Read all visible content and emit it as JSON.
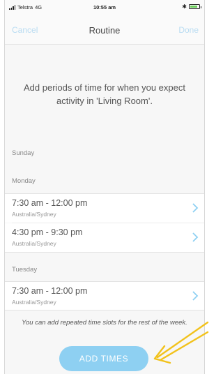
{
  "status_bar": {
    "carrier": "Telstra",
    "network": "4G",
    "time": "10:55 am"
  },
  "nav": {
    "cancel_label": "Cancel",
    "title": "Routine",
    "done_label": "Done"
  },
  "intro_text": "Add periods of time for when you expect activity in 'Living Room'.",
  "days": [
    {
      "label": "Sunday",
      "slots": []
    },
    {
      "label": "Monday",
      "slots": [
        {
          "time": "7:30 am - 12:00 pm",
          "zone": "Australia/Sydney"
        },
        {
          "time": "4:30 pm - 9:30 pm",
          "zone": "Australia/Sydney"
        }
      ]
    },
    {
      "label": "Tuesday",
      "slots": [
        {
          "time": "7:30 am - 12:00 pm",
          "zone": "Australia/Sydney"
        }
      ]
    }
  ],
  "hint_text": "You can add repeated time slots for the rest of the week.",
  "add_times_label": "ADD TIMES",
  "colors": {
    "accent": "#8ed0f2",
    "nav_link": "#b9dcf2",
    "annotation_arrow": "#f2c21b"
  },
  "icons": {
    "chevron": "chevron-right-icon",
    "signal": "signal-icon",
    "bluetooth": "bluetooth-icon",
    "battery": "battery-icon"
  }
}
